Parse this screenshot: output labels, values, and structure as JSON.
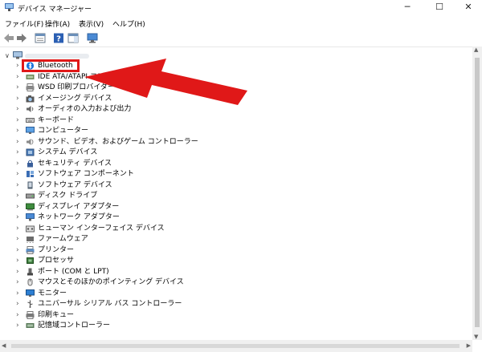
{
  "window": {
    "title": "デバイス マネージャー"
  },
  "menu": {
    "items": [
      "ファイル(F)",
      "操作(A)",
      "表示(V)",
      "ヘルプ(H)"
    ]
  },
  "tree": {
    "items": [
      {
        "label": "Bluetooth",
        "icon": "bluetooth-icon"
      },
      {
        "label": "IDE ATA/ATAPI コントローラー",
        "icon": "ide-controller-icon"
      },
      {
        "label": "WSD 印刷プロバイダー",
        "icon": "printer-provider-icon"
      },
      {
        "label": "イメージング デバイス",
        "icon": "camera-icon"
      },
      {
        "label": "オーディオの入力および出力",
        "icon": "speaker-icon"
      },
      {
        "label": "キーボード",
        "icon": "keyboard-icon"
      },
      {
        "label": "コンピューター",
        "icon": "computer-icon"
      },
      {
        "label": "サウンド、ビデオ、およびゲーム コントローラー",
        "icon": "sound-icon"
      },
      {
        "label": "システム デバイス",
        "icon": "system-device-icon"
      },
      {
        "label": "セキュリティ デバイス",
        "icon": "security-device-icon"
      },
      {
        "label": "ソフトウェア コンポーネント",
        "icon": "software-component-icon"
      },
      {
        "label": "ソフトウェア デバイス",
        "icon": "software-device-icon"
      },
      {
        "label": "ディスク ドライブ",
        "icon": "disk-drive-icon"
      },
      {
        "label": "ディスプレイ アダプター",
        "icon": "display-adapter-icon"
      },
      {
        "label": "ネットワーク アダプター",
        "icon": "network-adapter-icon"
      },
      {
        "label": "ヒューマン インターフェイス デバイス",
        "icon": "hid-icon"
      },
      {
        "label": "ファームウェア",
        "icon": "firmware-icon"
      },
      {
        "label": "プリンター",
        "icon": "printer-icon"
      },
      {
        "label": "プロセッサ",
        "icon": "processor-icon"
      },
      {
        "label": "ポート (COM と LPT)",
        "icon": "port-icon"
      },
      {
        "label": "マウスとそのほかのポインティング デバイス",
        "icon": "mouse-icon"
      },
      {
        "label": "モニター",
        "icon": "monitor-icon"
      },
      {
        "label": "ユニバーサル シリアル バス コントローラー",
        "icon": "usb-icon"
      },
      {
        "label": "印刷キュー",
        "icon": "print-queue-icon"
      },
      {
        "label": "記憶域コントローラー",
        "icon": "storage-controller-icon"
      }
    ]
  },
  "colors": {
    "highlight": "#e01818",
    "arrow": "#e01818",
    "accent": "#1a73d9"
  }
}
